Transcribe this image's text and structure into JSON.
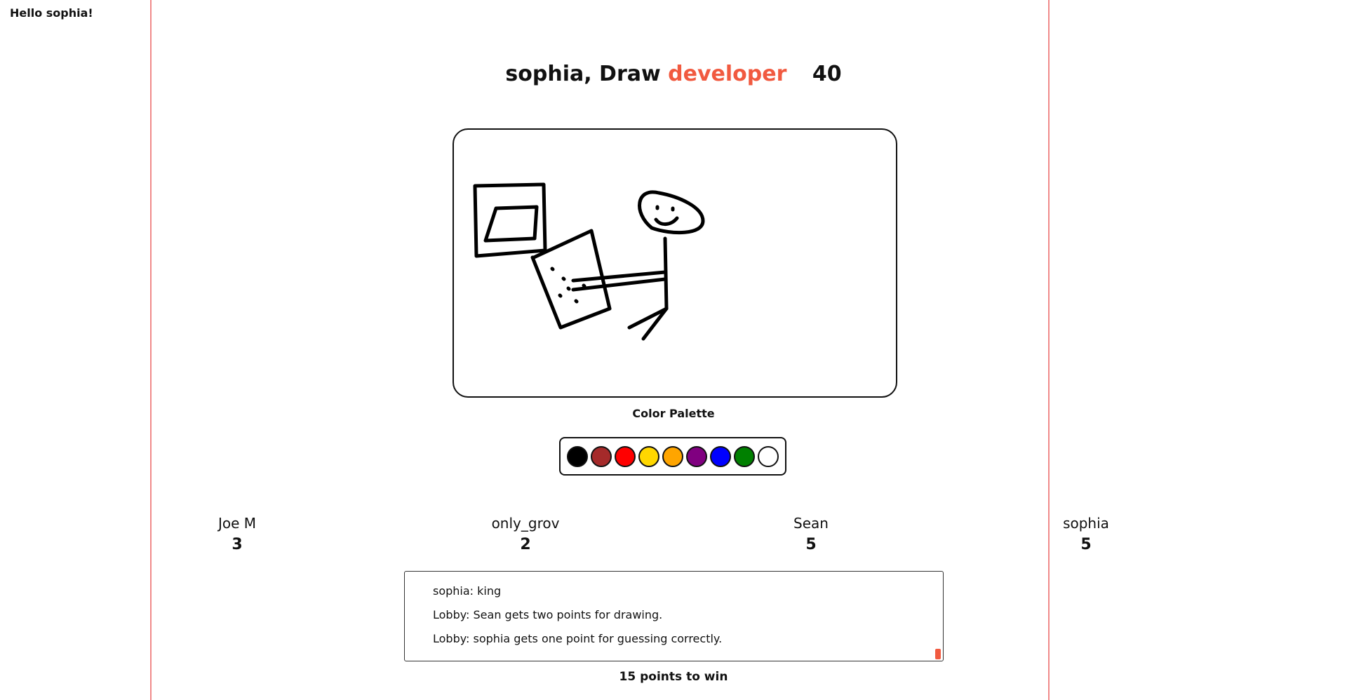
{
  "header": {
    "greeting": "Hello sophia!",
    "title_prefix": "sophia, Draw",
    "word": "developer",
    "timer": "40"
  },
  "palette": {
    "label": "Color Palette",
    "colors": [
      "#000000",
      "#a52a2a",
      "#ff0000",
      "#ffd700",
      "#ffa500",
      "#800080",
      "#0000ff",
      "#008000",
      "#ffffff"
    ]
  },
  "players": [
    {
      "name": "Joe M",
      "score": "3"
    },
    {
      "name": "only_grov",
      "score": "2"
    },
    {
      "name": "Sean",
      "score": "5"
    },
    {
      "name": "sophia",
      "score": "5"
    }
  ],
  "chat": {
    "messages": [
      "sophia: king",
      "Lobby: Sean gets two points for drawing.",
      "Lobby: sophia gets one point for guessing correctly."
    ]
  },
  "footer": {
    "win_text": "15 points to win"
  }
}
